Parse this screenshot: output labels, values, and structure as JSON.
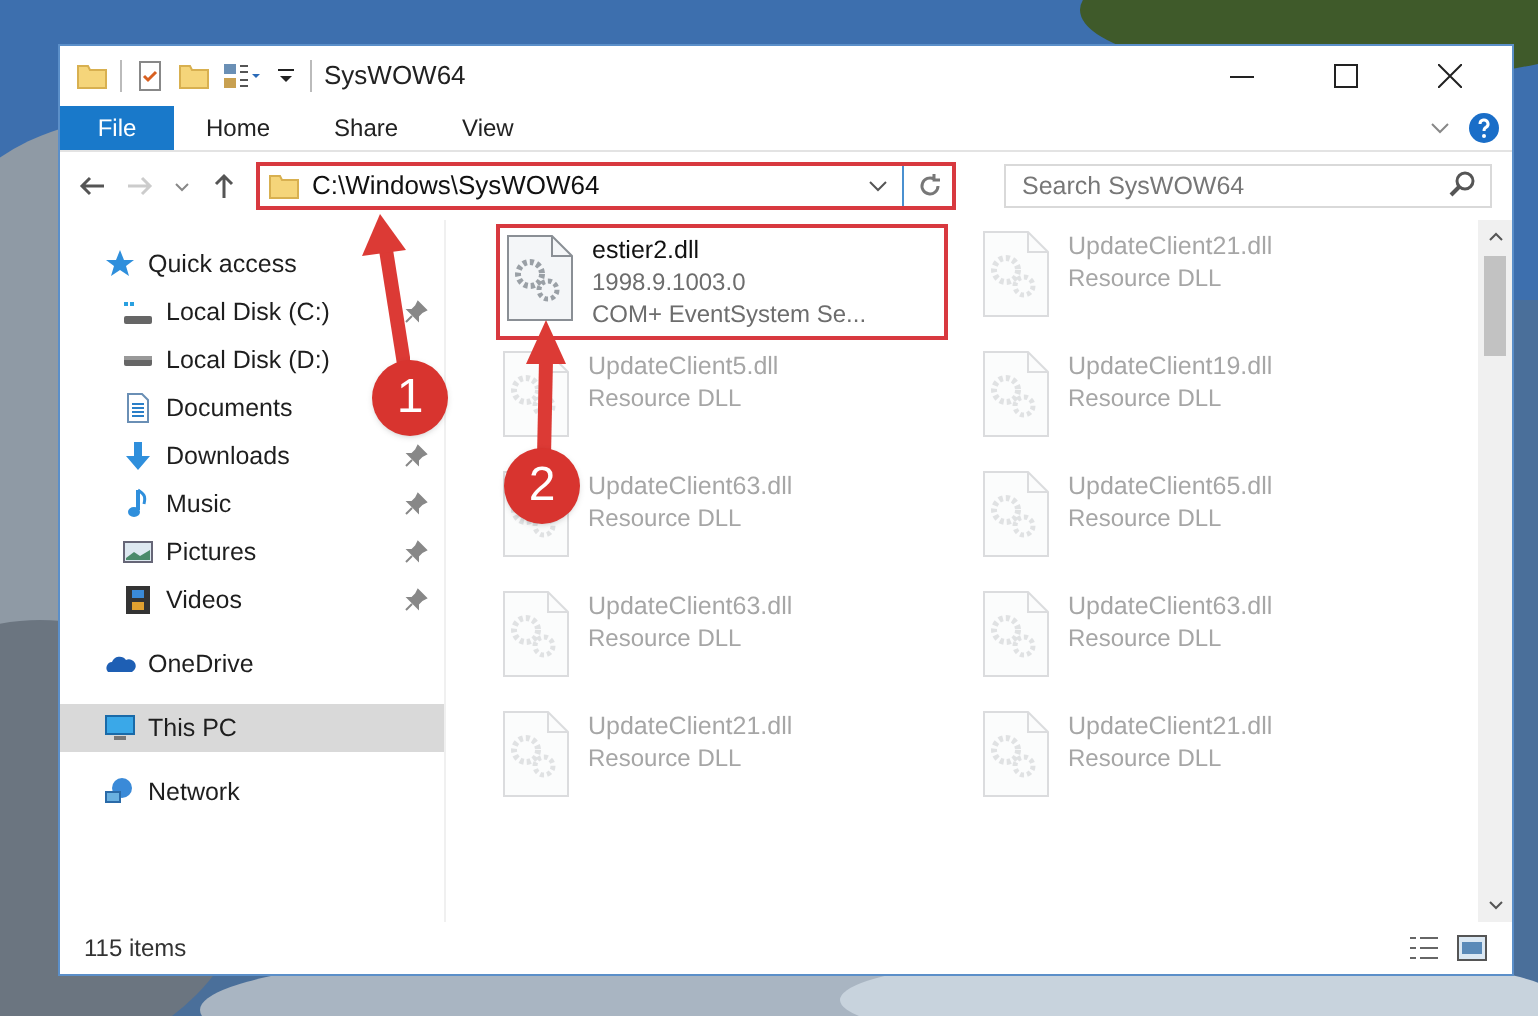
{
  "window": {
    "title": "SysWOW64"
  },
  "ribbon_tabs": [
    {
      "label": "File",
      "selected": true
    },
    {
      "label": "Home",
      "selected": false
    },
    {
      "label": "Share",
      "selected": false
    },
    {
      "label": "View",
      "selected": false
    }
  ],
  "address_bar": {
    "value": "C:\\Windows\\SysWOW64"
  },
  "search": {
    "placeholder": "Search SysWOW64"
  },
  "sidebar": {
    "items": [
      {
        "label": "Quick access",
        "kind": "star",
        "selected": false,
        "children": [
          {
            "label": "Local Disk (C:)",
            "kind": "drive-c",
            "pinned": true,
            "selected": false
          },
          {
            "label": "Local Disk (D:)",
            "kind": "drive",
            "selected": false
          },
          {
            "label": "Documents",
            "kind": "documents",
            "selected": false
          },
          {
            "label": "Downloads",
            "kind": "downloads",
            "pinned": true,
            "selected": false
          },
          {
            "label": "Music",
            "kind": "music",
            "pinned": true,
            "selected": false
          },
          {
            "label": "Pictures",
            "kind": "pictures",
            "pinned": true,
            "selected": false
          },
          {
            "label": "Videos",
            "kind": "videos",
            "pinned": true,
            "selected": false
          }
        ]
      },
      {
        "label": "OneDrive",
        "kind": "cloud",
        "selected": false
      },
      {
        "label": "This PC",
        "kind": "pc",
        "selected": true
      },
      {
        "label": "Network",
        "kind": "network",
        "selected": false
      }
    ]
  },
  "files": [
    {
      "name": "estier2.dll",
      "lines": [
        "1998.9.1003.0",
        "COM+ EventSystem Se..."
      ],
      "faded": false
    },
    {
      "name": "UpdateClient21.dll",
      "lines": [
        "Resource DLL"
      ],
      "faded": true
    },
    {
      "name": "UpdateClient5.dll",
      "lines": [
        "Resource DLL"
      ],
      "faded": true
    },
    {
      "name": "UpdateClient19.dll",
      "lines": [
        "Resource DLL"
      ],
      "faded": true
    },
    {
      "name": "UpdateClient63.dll",
      "lines": [
        "Resource DLL"
      ],
      "faded": true
    },
    {
      "name": "UpdateClient65.dll",
      "lines": [
        "Resource DLL"
      ],
      "faded": true
    },
    {
      "name": "UpdateClient63.dll",
      "lines": [
        "Resource DLL"
      ],
      "faded": true
    },
    {
      "name": "UpdateClient63.dll",
      "lines": [
        "Resource DLL"
      ],
      "faded": true
    },
    {
      "name": "UpdateClient21.dll",
      "lines": [
        "Resource DLL"
      ],
      "faded": true
    },
    {
      "name": "UpdateClient21.dll",
      "lines": [
        "Resource DLL"
      ],
      "faded": true
    }
  ],
  "status_bar": {
    "item_count": "115 items"
  },
  "annotations": [
    {
      "number": "1"
    },
    {
      "number": "2"
    }
  ]
}
